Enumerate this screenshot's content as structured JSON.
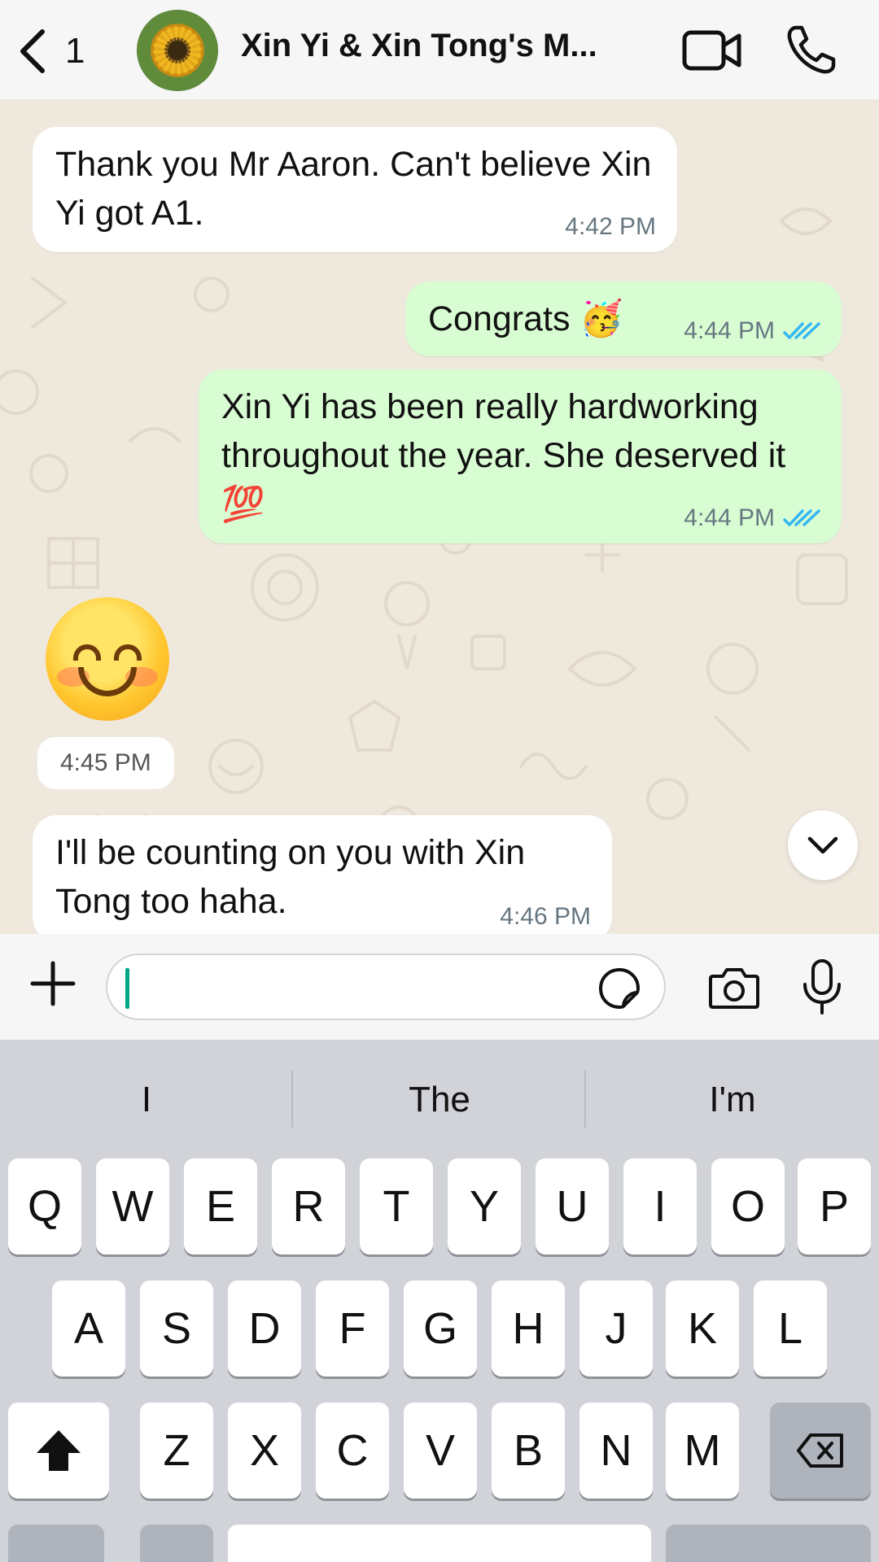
{
  "header": {
    "unread_count": "1",
    "chat_title": "Xin Yi & Xin Tong's M..."
  },
  "messages": [
    {
      "direction": "incoming",
      "text": "Thank you Mr Aaron. Can't believe Xin Yi got A1.",
      "time": "4:42 PM"
    },
    {
      "direction": "outgoing",
      "text": "Congrats 🥳",
      "time": "4:44 PM",
      "read": true
    },
    {
      "direction": "outgoing",
      "text": "Xin Yi has been really hardworking throughout the year. She deserved it 💯",
      "time": "4:44 PM",
      "read": true
    },
    {
      "direction": "incoming",
      "type": "emoji",
      "emoji_name": "smiling-face-with-smiling-eyes",
      "time": "4:45 PM"
    },
    {
      "direction": "incoming",
      "text": "I'll be counting on you with Xin Tong too haha.",
      "time": "4:46 PM"
    }
  ],
  "input": {
    "value": "",
    "placeholder": ""
  },
  "keyboard": {
    "suggestions": [
      "I",
      "The",
      "I'm"
    ],
    "row1": [
      "Q",
      "W",
      "E",
      "R",
      "T",
      "Y",
      "U",
      "I",
      "O",
      "P"
    ],
    "row2": [
      "A",
      "S",
      "D",
      "F",
      "G",
      "H",
      "J",
      "K",
      "L"
    ],
    "row3": [
      "Z",
      "X",
      "C",
      "V",
      "B",
      "N",
      "M"
    ]
  },
  "icons": {
    "back": "chevron-left-icon",
    "video": "video-camera-icon",
    "call": "phone-icon",
    "scroll": "chevron-down-icon",
    "plus": "plus-icon",
    "sticker": "sticker-icon",
    "camera": "camera-icon",
    "mic": "microphone-icon",
    "shift": "shift-icon",
    "delete": "backspace-icon"
  },
  "colors": {
    "incoming_bubble": "#FFFFFF",
    "outgoing_bubble": "#D9FDD3",
    "read_ticks": "#34B7F1",
    "wallpaper": "#EFE8DD",
    "keyboard_bg": "#D1D3D9",
    "caret": "#00A884"
  }
}
